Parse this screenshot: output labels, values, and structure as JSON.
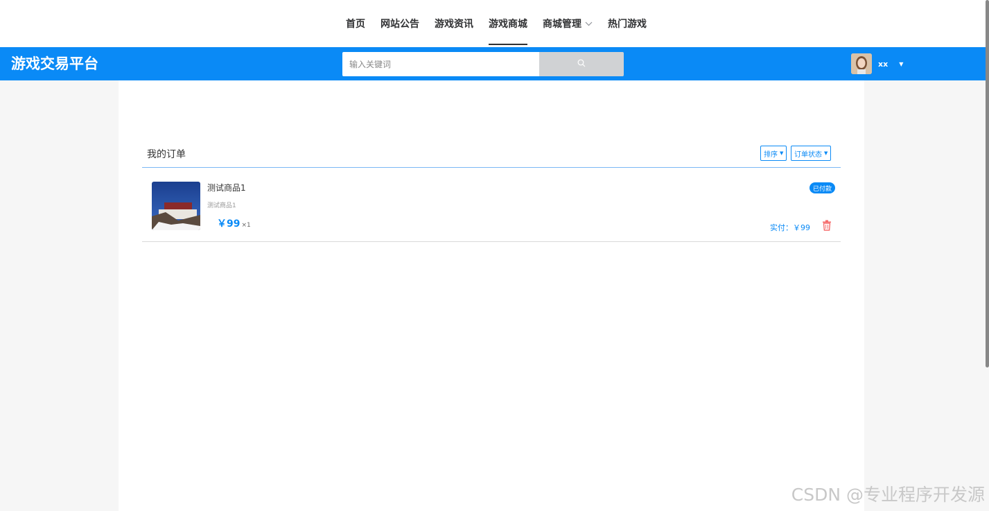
{
  "topnav": {
    "items": [
      {
        "label": "首页"
      },
      {
        "label": "网站公告"
      },
      {
        "label": "游戏资讯"
      },
      {
        "label": "游戏商城"
      },
      {
        "label": "商城管理"
      },
      {
        "label": "热门游戏"
      }
    ]
  },
  "header": {
    "logo": "游戏交易平台",
    "search_placeholder": "输入关键词",
    "username": "xx"
  },
  "orders": {
    "title": "我的订单",
    "sort_label": "排序",
    "status_filter_label": "订单状态",
    "items": [
      {
        "name": "测试商品1",
        "desc": "测试商品1",
        "price": "￥99",
        "qty": "×1",
        "status": "已付款",
        "paid": "实付：￥99"
      }
    ]
  },
  "watermark": "CSDN @专业程序开发源",
  "colors": {
    "primary": "#0a8af6",
    "delete": "#f56c6c"
  }
}
